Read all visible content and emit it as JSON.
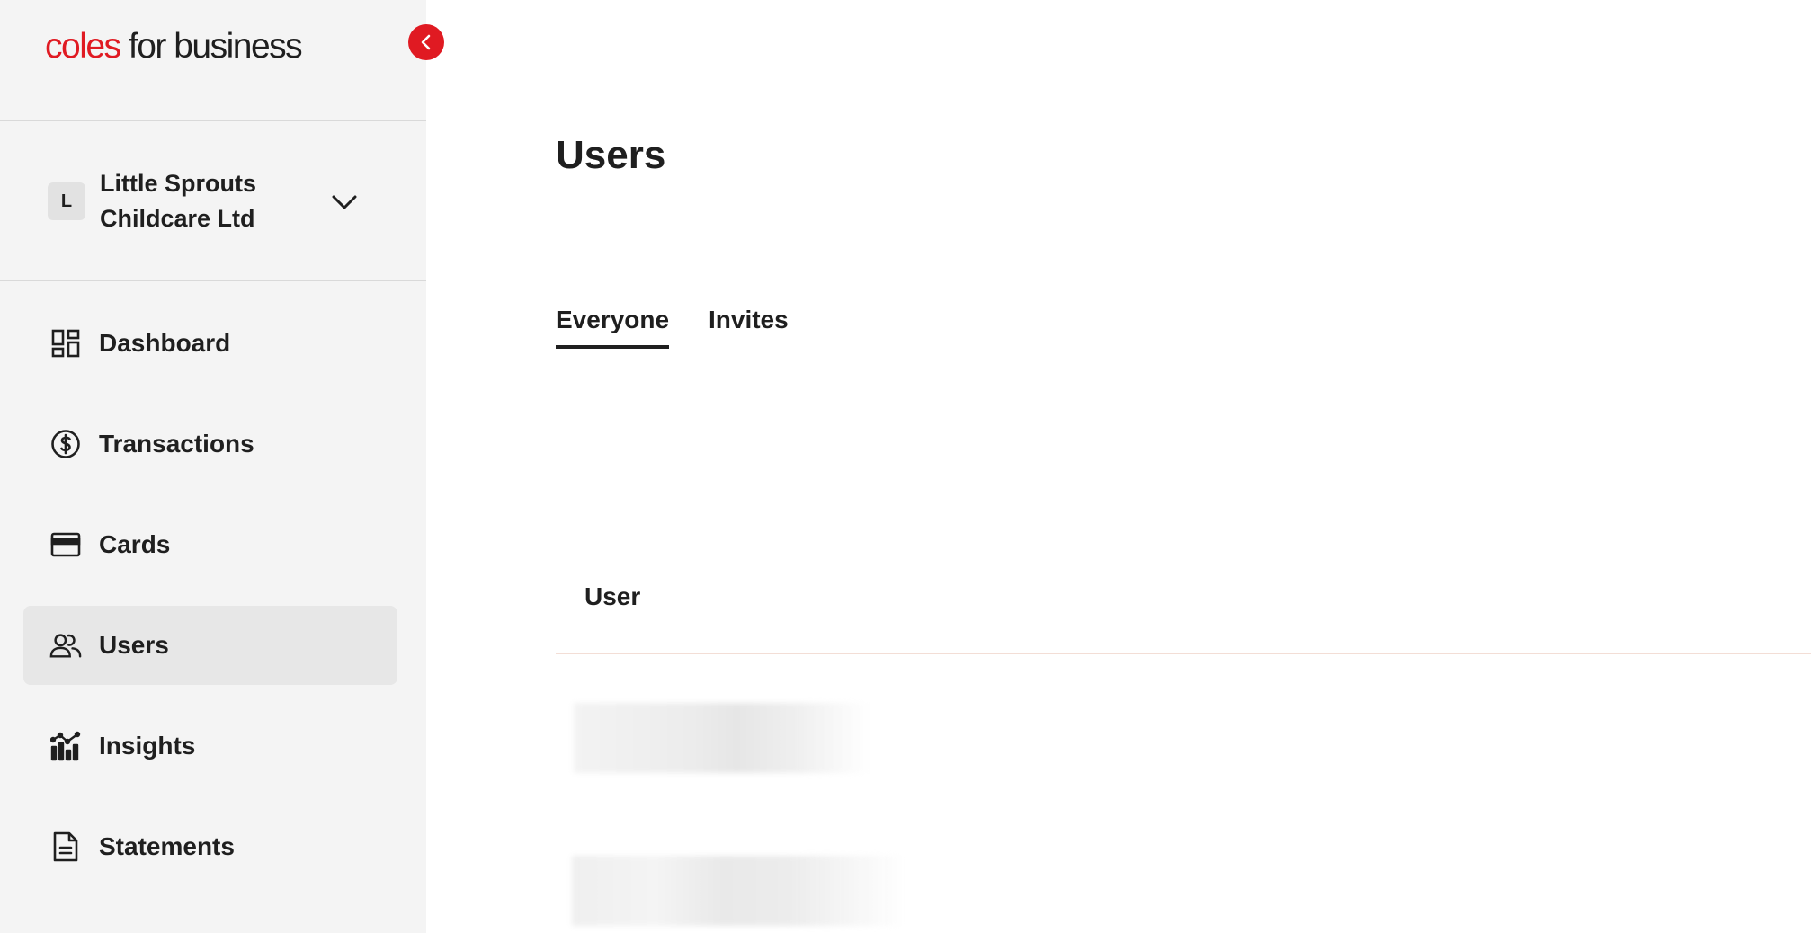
{
  "sidebar": {
    "logo": {
      "brand": "coles",
      "rest": " for business"
    },
    "collapse_label": "Collapse sidebar",
    "organization": {
      "initial": "L",
      "name": "Little Sprouts Childcare Ltd"
    },
    "nav": [
      {
        "label": "Dashboard",
        "icon": "dashboard-icon"
      },
      {
        "label": "Transactions",
        "icon": "dollar-circle-icon"
      },
      {
        "label": "Cards",
        "icon": "credit-card-icon"
      },
      {
        "label": "Users",
        "icon": "users-icon",
        "active": true
      },
      {
        "label": "Insights",
        "icon": "insights-chart-icon"
      },
      {
        "label": "Statements",
        "icon": "document-icon"
      }
    ]
  },
  "main": {
    "title": "Users",
    "tabs": [
      {
        "label": "Everyone",
        "active": true
      },
      {
        "label": "Invites",
        "active": false
      }
    ],
    "table": {
      "columns": [
        "User"
      ],
      "rows_obscured": 2
    }
  },
  "colors": {
    "brand_red": "#e01a22",
    "sidebar_bg": "#f4f4f4",
    "active_nav_bg": "#e7e7e7",
    "text": "#1f1f1f",
    "table_rule": "#f3ded6"
  }
}
